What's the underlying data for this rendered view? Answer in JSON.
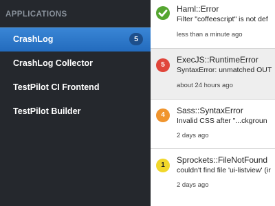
{
  "sidebar": {
    "section_title": "APPLICATIONS",
    "apps": [
      {
        "label": "CrashLog",
        "badge": "5",
        "active": true
      },
      {
        "label": "CrashLog Collector"
      },
      {
        "label": "TestPilot CI Frontend"
      },
      {
        "label": "TestPilot Builder"
      }
    ],
    "colors": {
      "background": "#25282d",
      "active": "#2e78cb",
      "badge": "#1d4f8c",
      "heading": "#8a929c"
    }
  },
  "errors": [
    {
      "icon": "checkmark-icon",
      "status": "resolved",
      "badge": "",
      "color": "#55a630",
      "title": "Haml::Error",
      "message": "Filter \"coffeescript\" is not def",
      "time": "less than a minute ago"
    },
    {
      "icon": "count-badge-icon",
      "badge": "5",
      "color": "#e0453a",
      "selected": true,
      "title": "ExecJS::RuntimeError",
      "message": "SyntaxError: unmatched OUT",
      "time": "about 24 hours ago"
    },
    {
      "icon": "count-badge-icon",
      "badge": "4",
      "color": "#f0952e",
      "title": "Sass::SyntaxError",
      "message": "Invalid CSS after \"...ckgroun",
      "time": "2 days ago"
    },
    {
      "icon": "count-badge-icon",
      "badge": "1",
      "color": "#f1d72a",
      "title": "Sprockets::FileNotFound",
      "message": "couldn't find file 'ui-listview' (ir",
      "time": "2 days ago"
    }
  ]
}
